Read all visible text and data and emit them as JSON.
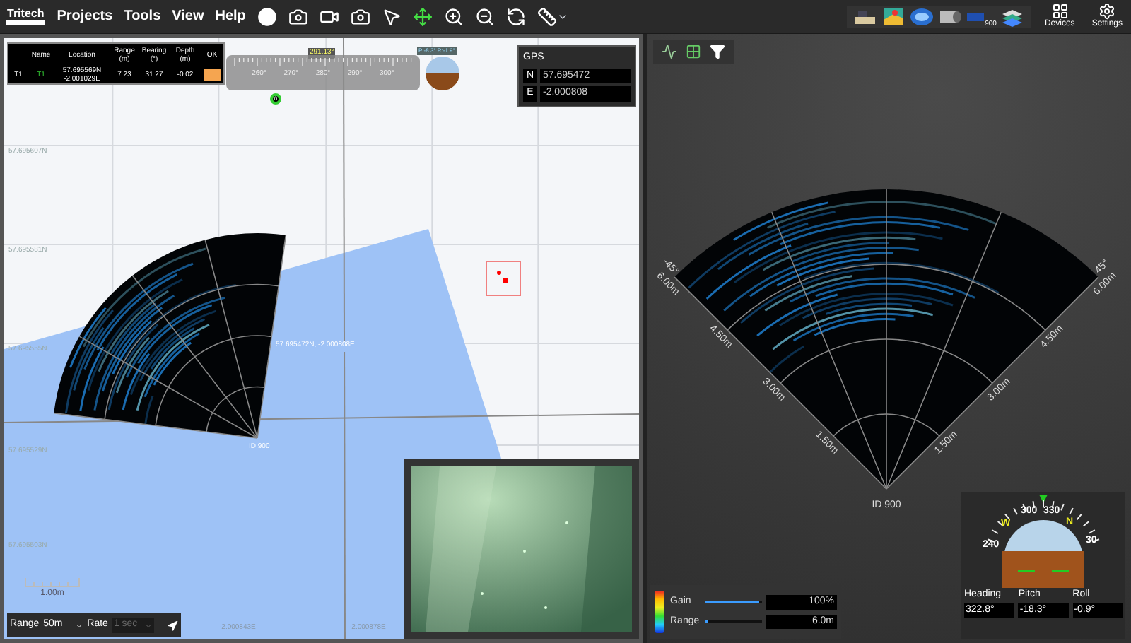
{
  "menu": {
    "logo": "Tritech",
    "items": [
      "Projects",
      "Tools",
      "View",
      "Help"
    ]
  },
  "device_bar": {
    "badge": "900",
    "buttons": [
      "Devices",
      "Settings"
    ]
  },
  "targets": {
    "columns": [
      "Name",
      "Location",
      "Range (m)",
      "Bearing (°)",
      "Depth (m)",
      "OK"
    ],
    "rows": [
      {
        "id": "T1",
        "name": "T1",
        "location": [
          "57.695569N",
          "-2.001029E"
        ],
        "range": "7.23",
        "bearing": "31.27",
        "depth": "-0.02",
        "ok": true
      }
    ]
  },
  "heading_ruler": {
    "reading": "291.13°",
    "ticks": [
      "260°",
      "270°",
      "280°",
      "290°",
      "300°"
    ],
    "marker": "0"
  },
  "attitude_badge": {
    "reading": "P:-8.3° R:-1.9°"
  },
  "gps": {
    "title": "GPS",
    "fields": [
      {
        "label": "N",
        "value": "57.695472"
      },
      {
        "label": "E",
        "value": "-2.000808"
      }
    ]
  },
  "map": {
    "lat_labels": [
      "57.695607N",
      "57.695581N",
      "57.695555N",
      "57.695529N",
      "57.695503N"
    ],
    "lon_labels": [
      "-2.000843E",
      "-2.000878E"
    ],
    "position_label": "57.695472N, -2.000808E",
    "sonar_label": "ID 900",
    "scale": "1.00m"
  },
  "map_controls": {
    "range": {
      "label": "Range",
      "value": "50m"
    },
    "rate": {
      "label": "Rate",
      "value": "1 sec",
      "disabled": true
    }
  },
  "sonar": {
    "angles": [
      "-45°",
      "45°"
    ],
    "range_labels_left": [
      "6.00m",
      "4.50m",
      "3.00m",
      "1.50m"
    ],
    "range_labels_right": [
      "6.00m",
      "4.50m",
      "3.00m",
      "1.50m"
    ],
    "id": "ID 900"
  },
  "sliders": [
    {
      "label": "Gain",
      "level": 0.95,
      "value": "100%"
    },
    {
      "label": "Range",
      "level": 0.05,
      "value": "6.0m"
    }
  ],
  "attitude": {
    "compass": [
      {
        "text": "240",
        "kind": "number"
      },
      {
        "text": "W",
        "kind": "cardinal"
      },
      {
        "text": "300",
        "kind": "number"
      },
      {
        "text": "330",
        "kind": "number"
      },
      {
        "text": "N",
        "kind": "cardinal"
      },
      {
        "text": "30",
        "kind": "number"
      }
    ],
    "readouts": [
      {
        "label": "Heading",
        "value": "322.8°"
      },
      {
        "label": "Pitch",
        "value": "-18.3°"
      },
      {
        "label": "Roll",
        "value": "-0.9°"
      }
    ]
  }
}
